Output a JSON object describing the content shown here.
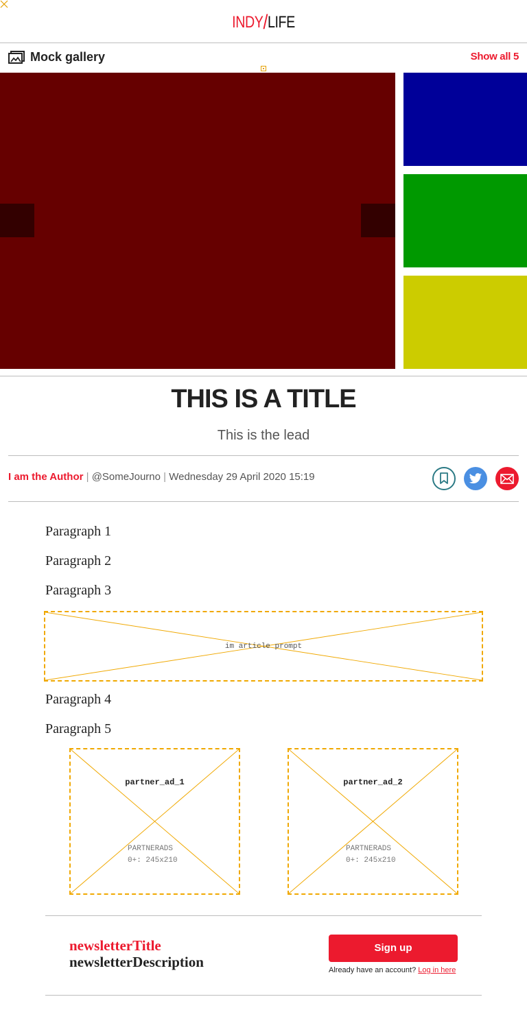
{
  "header": {
    "logo_part1": "INDY",
    "logo_part2": "LIFE"
  },
  "gallery": {
    "title": "Mock gallery",
    "show_all_label": "Show all 5",
    "colors": {
      "main": "#660000",
      "nav": "#330000",
      "thumb1": "#000099",
      "thumb2": "#009900",
      "thumb3": "#cccc00"
    }
  },
  "article": {
    "title": "THIS IS A TITLE",
    "lead": "This is the lead",
    "author": "I am the Author",
    "handle": "@SomeJourno",
    "date": "Wednesday 29 April 2020 15:19",
    "paragraphs": [
      "Paragraph 1",
      "Paragraph 2",
      "Paragraph 3",
      "Paragraph 4",
      "Paragraph 5"
    ]
  },
  "ads": {
    "in_article": {
      "label": "im article prompt"
    },
    "partner1": {
      "name": "partner_ad_1",
      "line1": "PARTNERADS",
      "line2": "0+: 245x210"
    },
    "partner2": {
      "name": "partner_ad_2",
      "line1": "PARTNERADS",
      "line2": "0+: 245x210"
    }
  },
  "newsletter": {
    "title": "newsletterTitle",
    "description": "newsletterDescription",
    "signup_label": "Sign up",
    "account_prompt": "Already have an account?",
    "login_link": "Log in here"
  },
  "brand": {
    "accent": "#ec1a2e",
    "twitter": "#4a8fe2",
    "bookmark": "#2b7a85"
  }
}
